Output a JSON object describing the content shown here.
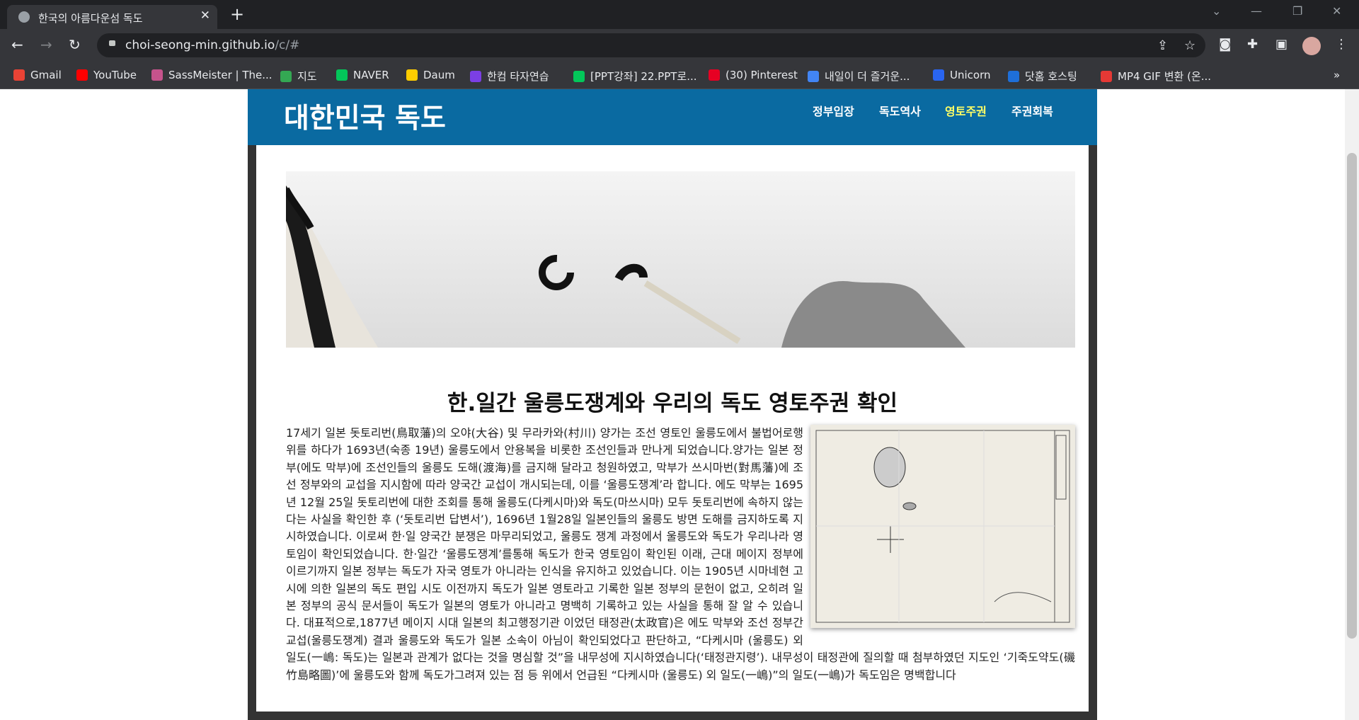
{
  "browser": {
    "tab_title": "한국의 아름다운섬 독도",
    "url_host": "choi-seong-min.github.io",
    "url_path": "/c/#",
    "bookmarks": [
      {
        "label": "Gmail",
        "color": "#ea4335"
      },
      {
        "label": "YouTube",
        "color": "#ff0000"
      },
      {
        "label": "SassMeister | The...",
        "color": "#c6538c"
      },
      {
        "label": "지도",
        "color": "#34a853"
      },
      {
        "label": "NAVER",
        "color": "#03c75a"
      },
      {
        "label": "Daum",
        "color": "#ffcd00"
      },
      {
        "label": "한컴 타자연습",
        "color": "#7b3fe4"
      },
      {
        "label": "[PPT강좌] 22.PPT로...",
        "color": "#03c75a"
      },
      {
        "label": "(30) Pinterest",
        "color": "#e60023"
      },
      {
        "label": "내일이 더 즐거운...",
        "color": "#4285f4"
      },
      {
        "label": "Unicorn",
        "color": "#2965f1"
      },
      {
        "label": "닷홈 호스팅",
        "color": "#1e6fd9"
      },
      {
        "label": "MP4 GIF 변환 (온...",
        "color": "#e53935"
      }
    ],
    "more_bookmarks": "»"
  },
  "site": {
    "title": "대한민국 독도",
    "nav": [
      {
        "label": "정부입장",
        "active": false
      },
      {
        "label": "독도역사",
        "active": false
      },
      {
        "label": "영토주권",
        "active": true
      },
      {
        "label": "주권회복",
        "active": false
      }
    ],
    "accent_color": "#0a6aa1",
    "active_nav_color": "#ffff66"
  },
  "article": {
    "heading": "한.일간 울릉도쟁계와 우리의 독도 영토주권 확인",
    "body": "17세기 일본 돗토리번(鳥取藩)의 오야(大谷) 및 무라카와(村川) 양가는 조선 영토인 울릉도에서 불법어로행위를 하다가 1693년(숙종 19년) 울릉도에서 안용복을 비롯한 조선인들과 만나게 되었습니다.양가는 일본 정부(에도 막부)에 조선인들의 울릉도 도해(渡海)를 금지해 달라고 청원하였고, 막부가 쓰시마번(對馬藩)에 조선 정부와의 교섭을 지시함에 따라 양국간 교섭이 개시되는데, 이를 ‘울릉도쟁계’라 합니다. 에도 막부는 1695년 12월 25일 돗토리번에 대한 조회를 통해 울릉도(다케시마)와 독도(마쓰시마) 모두 돗토리번에 속하지 않는다는 사실을 확인한 후 (‘돗토리번 답변서’), 1696년 1월28일 일본인들의 울릉도 방면 도해를 금지하도록 지시하였습니다. 이로써 한·일 양국간 분쟁은 마무리되었고, 울릉도 쟁계 과정에서 울릉도와 독도가 우리나라 영토임이 확인되었습니다. 한·일간 ‘울릉도쟁계’를통해 독도가 한국 영토임이 확인된 이래, 근대 메이지 정부에 이르기까지 일본 정부는 독도가 자국 영토가 아니라는 인식을 유지하고 있었습니다. 이는 1905년 시마네현 고시에 의한 일본의 독도 편입 시도 이전까지 독도가 일본 영토라고 기록한 일본 정부의 문헌이 없고, 오히려 일본 정부의 공식 문서들이 독도가 일본의 영토가 아니라고 명백히 기록하고 있는 사실을 통해 잘 알 수 있습니다. 대표적으로,1877년 메이지 시대 일본의 최고행정기관 이었던 태정관(太政官)은 에도 막부와 조선 정부간 교섭(울릉도쟁계) 결과 울릉도와 독도가 일본 소속이 아님이 확인되었다고 판단하고, “다케시마 (울릉도) 외 일도(一嶋: 독도)는 일본과 관계가 없다는 것을 명심할 것”을 내무성에 지시하였습니다(‘태정관지령’). 내무성이 태정관에 질의할 때 첨부하였던 지도인 ‘기죽도약도(磯竹島略圖)’에 울릉도와 함께 독도가그려져 있는 점 등 위에서 언급된 “다케시마 (울릉도) 외 일도(一嶋)”의 일도(一嶋)가 독도임은 명백합니다"
  }
}
